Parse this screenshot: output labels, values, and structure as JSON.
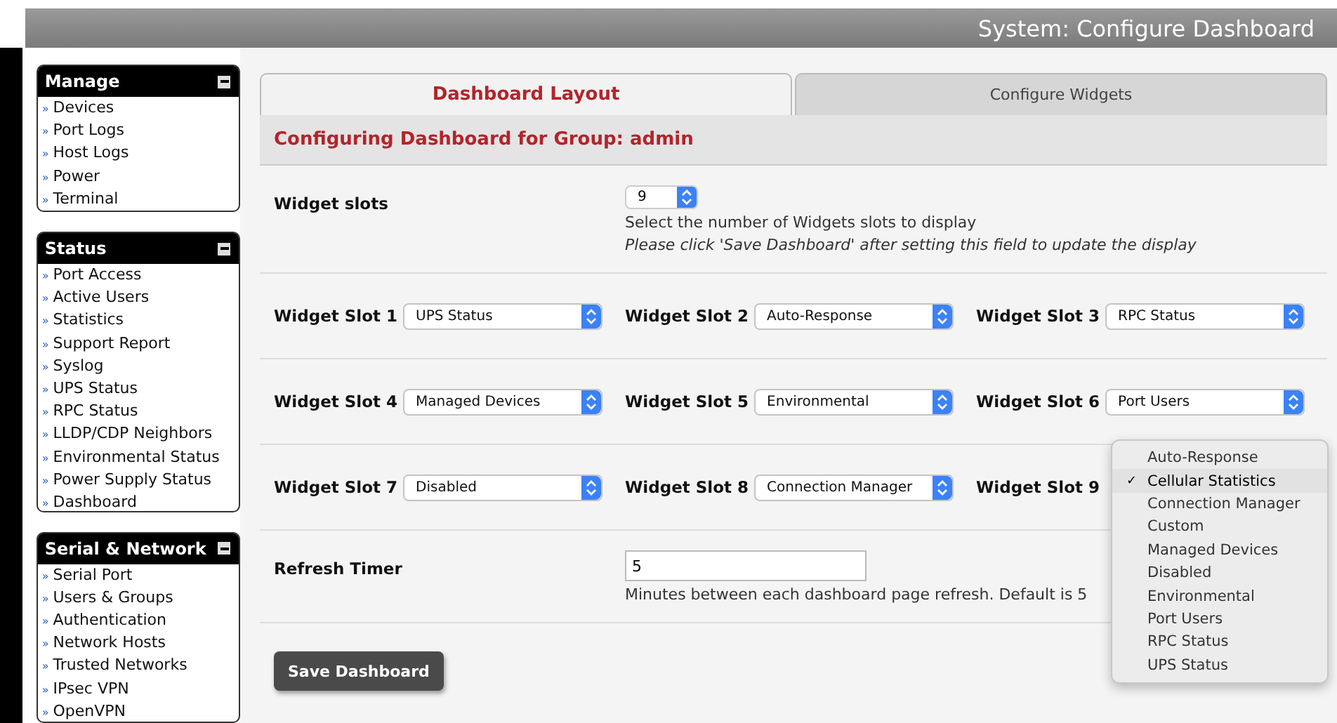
{
  "header": {
    "title": "System: Configure Dashboard"
  },
  "sidebar": {
    "bullet": "»",
    "panels": [
      {
        "title": "Manage",
        "items": [
          "Devices",
          "Port Logs",
          "Host Logs",
          "Power",
          "Terminal"
        ]
      },
      {
        "title": "Status",
        "items": [
          "Port Access",
          "Active Users",
          "Statistics",
          "Support Report",
          "Syslog",
          "UPS Status",
          "RPC Status",
          "LLDP/CDP Neighbors",
          "Environmental Status",
          "Power Supply Status",
          "Dashboard"
        ]
      },
      {
        "title": "Serial & Network",
        "items": [
          "Serial Port",
          "Users & Groups",
          "Authentication",
          "Network Hosts",
          "Trusted Networks",
          "IPsec VPN",
          "OpenVPN"
        ]
      }
    ]
  },
  "tabs": [
    {
      "label": "Dashboard Layout",
      "selected": true
    },
    {
      "label": "Configure Widgets",
      "selected": false
    }
  ],
  "section_title": "Configuring Dashboard for Group: admin",
  "widget_slots": {
    "label": "Widget slots",
    "value": "9",
    "help": "Select the number of Widgets slots to display",
    "note": "Please click 'Save Dashboard' after setting this field to update the display"
  },
  "slots": [
    {
      "label": "Widget Slot 1",
      "value": "UPS Status"
    },
    {
      "label": "Widget Slot 2",
      "value": "Auto-Response"
    },
    {
      "label": "Widget Slot 3",
      "value": "RPC Status"
    },
    {
      "label": "Widget Slot 4",
      "value": "Managed Devices"
    },
    {
      "label": "Widget Slot 5",
      "value": "Environmental"
    },
    {
      "label": "Widget Slot 6",
      "value": "Port Users"
    },
    {
      "label": "Widget Slot 7",
      "value": "Disabled"
    },
    {
      "label": "Widget Slot 8",
      "value": "Connection Manager"
    },
    {
      "label": "Widget Slot 9"
    }
  ],
  "dropdown": [
    {
      "label": "Auto-Response",
      "selected": false
    },
    {
      "label": "Cellular Statistics",
      "selected": true
    },
    {
      "label": "Connection Manager",
      "selected": false
    },
    {
      "label": "Custom",
      "selected": false
    },
    {
      "label": "Managed Devices",
      "selected": false
    },
    {
      "label": "Disabled",
      "selected": false
    },
    {
      "label": "Environmental",
      "selected": false
    },
    {
      "label": "Port Users",
      "selected": false
    },
    {
      "label": "RPC Status",
      "selected": false
    },
    {
      "label": "UPS Status",
      "selected": false
    }
  ],
  "check_mark": "✓",
  "refresh_timer": {
    "label": "Refresh Timer",
    "value": "5",
    "help": "Minutes between each dashboard page refresh. Default is 5"
  },
  "save_button": "Save Dashboard"
}
